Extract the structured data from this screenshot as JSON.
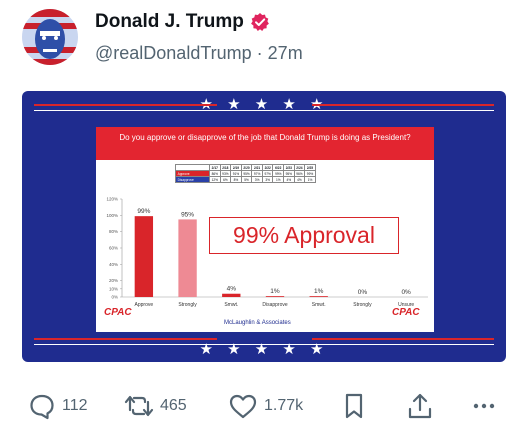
{
  "post": {
    "display_name": "Donald J. Trump",
    "handle": "@realDonaldTrump",
    "separator": " · ",
    "time": "27m"
  },
  "media": {
    "stars": "★ ★ ★ ★ ★",
    "slide_title": "Do you approve or disapprove of the job that Donald Trump is doing as President?",
    "table": {
      "headers": [
        "",
        "2/17",
        "2/18",
        "2/19",
        "2/20",
        "2/21",
        "2/22",
        "6/22",
        "2/23",
        "2/24",
        "2/25"
      ],
      "approve_label": "Approve",
      "approve": [
        "86%",
        "93%",
        "91%",
        "95%",
        "97%",
        "97%",
        "99%",
        "95%",
        "96%",
        "99%"
      ],
      "disapprove_label": "Disapprove",
      "disapprove": [
        "12%",
        "6%",
        "8%",
        "5%",
        "3%",
        "3%",
        "1%",
        "4%",
        "4%",
        "1%"
      ]
    },
    "approval_text": "99% Approval",
    "logo_text": "CPAC",
    "pollster": "McLaughlin & Associates",
    "bar_color_strong": "#d9252a",
    "bar_color_soft": "#ee8a94"
  },
  "chart_data": {
    "type": "bar",
    "categories": [
      "Approve",
      "Strongly",
      "Smwt.",
      "Disapprove",
      "Smwt.",
      "Strongly",
      "Unsure"
    ],
    "values": [
      99,
      95,
      4,
      1,
      1,
      0,
      0
    ],
    "data_labels": [
      "99%",
      "95%",
      "4%",
      "1%",
      "1%",
      "0%",
      "0%"
    ],
    "y_ticks": [
      "0%",
      "10%",
      "20%",
      "40%",
      "60%",
      "80%",
      "100%",
      "120%"
    ],
    "ylim": [
      0,
      120
    ]
  },
  "actions": {
    "reply_count": "112",
    "repost_count": "465",
    "like_count": "1.77k"
  }
}
